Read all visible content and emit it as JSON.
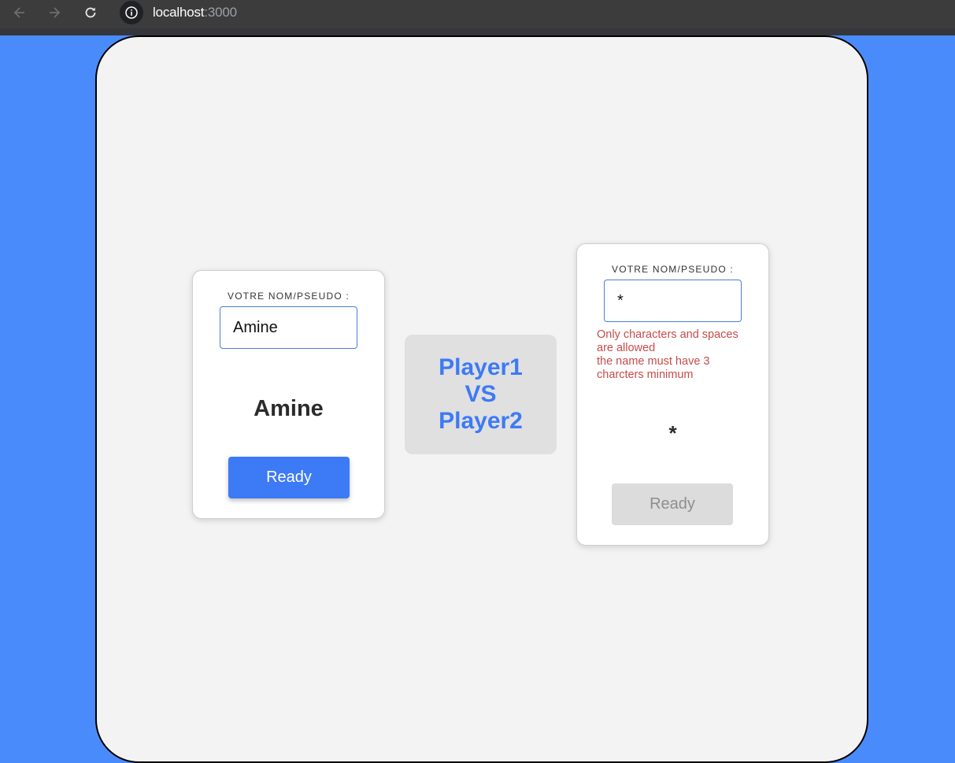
{
  "browser": {
    "url_host": "localhost",
    "url_port": ":3000",
    "icons": [
      "back-arrow-icon",
      "forward-arrow-icon",
      "reload-icon",
      "info-icon"
    ]
  },
  "player1": {
    "label": "VOTRE NOM/PSEUDO :",
    "input_value": "Amine",
    "display_name": "Amine",
    "ready_label": "Ready"
  },
  "versus": {
    "line1": "Player1",
    "line2": "VS",
    "line3": "Player2"
  },
  "player2": {
    "label": "VOTRE NOM/PSEUDO :",
    "input_value": "*",
    "error_line1": "Only characters and spaces are allowed",
    "error_line2": "the name must have 3 charcters minimum",
    "display_name": "*",
    "ready_label": "Ready"
  },
  "colors": {
    "background": "#4a8bfc",
    "accent": "#3d7af5",
    "error": "#c84b4b",
    "disabled": "#dcdcdc"
  }
}
